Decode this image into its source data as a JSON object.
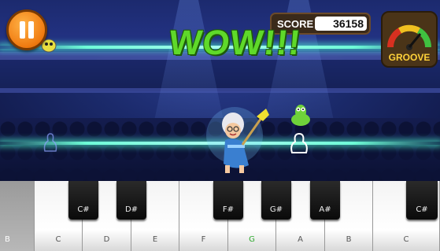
{
  "hud": {
    "pause_icon": "pause-icon",
    "score_label": "SCORE",
    "score_value": "36158",
    "feedback_text": "WOW!!!",
    "groove_label": "GROOVE",
    "groove_level": 0.72
  },
  "colors": {
    "pause_button": "#f07a10",
    "wow_text": "#5fd92a",
    "laser": "#6fffd8",
    "groove_label": "#ffd23a",
    "green_note": "#2faa2f"
  },
  "keyboard": {
    "white_keys": [
      {
        "note": "B"
      },
      {
        "note": "C"
      },
      {
        "note": "D"
      },
      {
        "note": "E"
      },
      {
        "note": "F"
      },
      {
        "note": "G"
      },
      {
        "note": "A"
      },
      {
        "note": "B"
      },
      {
        "note": "C"
      }
    ],
    "black_keys": [
      {
        "note": "C#"
      },
      {
        "note": "D#"
      },
      {
        "note": "F#"
      },
      {
        "note": "G#"
      },
      {
        "note": "A#"
      },
      {
        "note": "C#"
      }
    ],
    "highlight_note_color": "#2faa2f"
  }
}
